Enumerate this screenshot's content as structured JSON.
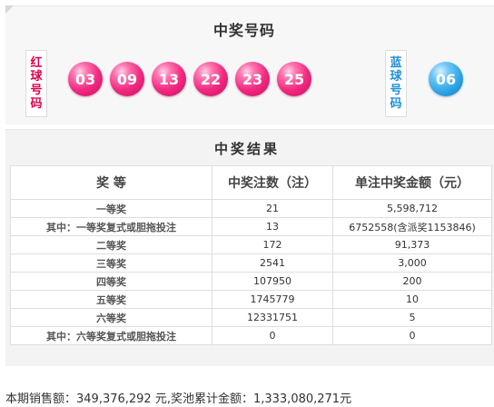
{
  "header": {
    "title": "中奖号码"
  },
  "red_tab": {
    "chars": [
      "红",
      "球",
      "号",
      "码"
    ]
  },
  "blue_tab": {
    "chars": [
      "蓝",
      "球",
      "号",
      "码"
    ]
  },
  "red_balls": [
    "03",
    "09",
    "13",
    "22",
    "23",
    "25"
  ],
  "blue_ball": "06",
  "colors": {
    "red_ball": "#f12a80",
    "blue_ball": "#2ea5e8",
    "red_text": "#e0004d",
    "blue_text": "#1f8fd8"
  },
  "results": {
    "title": "中奖结果",
    "headers": [
      "奖 等",
      "中奖注数（注）",
      "单注中奖金额（元）"
    ],
    "rows": [
      {
        "level": "一等奖",
        "count": "21",
        "amount": "5,598,712"
      },
      {
        "level": "其中：一等奖复式或胆拖投注",
        "count": "13",
        "amount": "6752558(含派奖1153846)"
      },
      {
        "level": "二等奖",
        "count": "172",
        "amount": "91,373"
      },
      {
        "level": "三等奖",
        "count": "2541",
        "amount": "3,000"
      },
      {
        "level": "四等奖",
        "count": "107950",
        "amount": "200"
      },
      {
        "level": "五等奖",
        "count": "1745779",
        "amount": "10"
      },
      {
        "level": "六等奖",
        "count": "12331751",
        "amount": "5"
      },
      {
        "level": "其中：六等奖复式或胆拖投注",
        "count": "0",
        "amount": "0"
      }
    ]
  },
  "footer": {
    "text": "本期销售额：349,376,292 元,奖池累计金额：1,333,080,271元"
  }
}
